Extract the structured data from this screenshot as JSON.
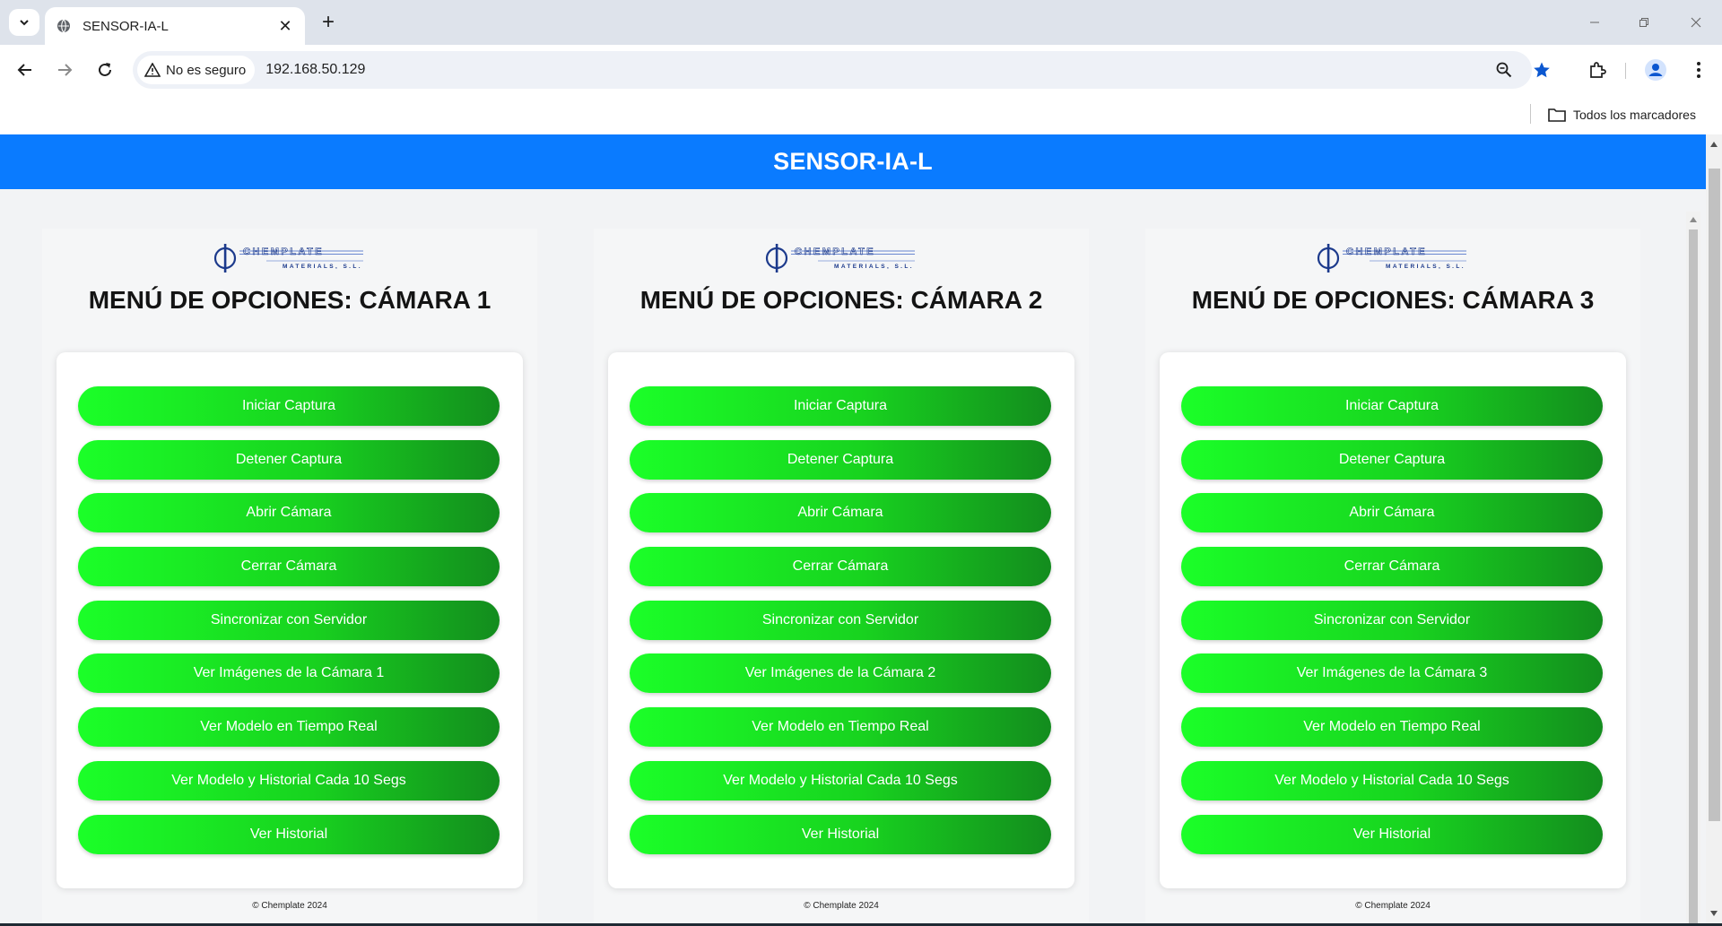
{
  "browser": {
    "tab_title": "SENSOR-IA-L",
    "security_label": "No es seguro",
    "url": "192.168.50.129",
    "bookmarks_all": "Todos los marcadores"
  },
  "page": {
    "title": "SENSOR-IA-L",
    "header_color": "#0a7bff",
    "button_colors": [
      "#1bff28",
      "#138c1e"
    ]
  },
  "cameras": [
    {
      "title": "MENÚ DE OPCIONES: CÁMARA 1",
      "buttons": [
        "Iniciar Captura",
        "Detener Captura",
        "Abrir Cámara",
        "Cerrar Cámara",
        "Sincronizar con Servidor",
        "Ver Imágenes de la Cámara 1",
        "Ver Modelo en Tiempo Real",
        "Ver Modelo y Historial Cada 10 Segs",
        "Ver Historial"
      ],
      "footer": "© Chemplate 2024"
    },
    {
      "title": "MENÚ DE OPCIONES: CÁMARA 2",
      "buttons": [
        "Iniciar Captura",
        "Detener Captura",
        "Abrir Cámara",
        "Cerrar Cámara",
        "Sincronizar con Servidor",
        "Ver Imágenes de la Cámara 2",
        "Ver Modelo en Tiempo Real",
        "Ver Modelo y Historial Cada 10 Segs",
        "Ver Historial"
      ],
      "footer": "© Chemplate 2024"
    },
    {
      "title": "MENÚ DE OPCIONES: CÁMARA 3",
      "buttons": [
        "Iniciar Captura",
        "Detener Captura",
        "Abrir Cámara",
        "Cerrar Cámara",
        "Sincronizar con Servidor",
        "Ver Imágenes de la Cámara 3",
        "Ver Modelo en Tiempo Real",
        "Ver Modelo y Historial Cada 10 Segs",
        "Ver Historial"
      ],
      "footer": "© Chemplate 2024"
    }
  ],
  "logo": {
    "name": "CHEMPLATE",
    "subtitle": "MATERIALS, S.L."
  }
}
